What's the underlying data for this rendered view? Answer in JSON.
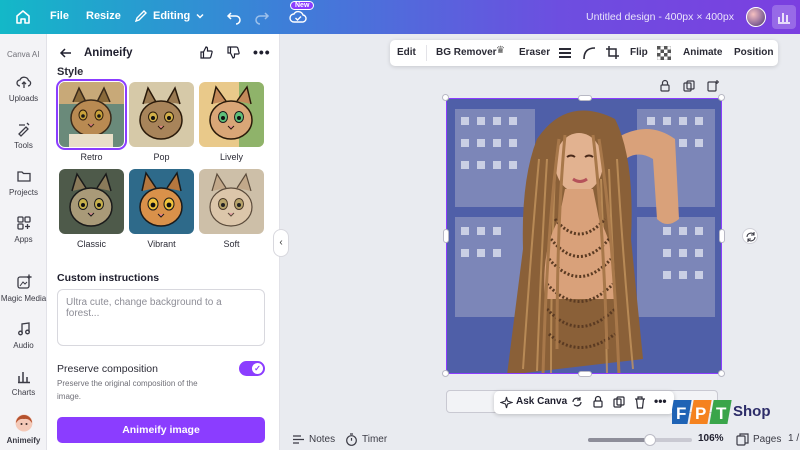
{
  "topbar": {
    "file_label": "File",
    "resize_label": "Resize",
    "mode_label": "Editing",
    "new_badge": "New",
    "document_title": "Untitled design - 400px × 400px"
  },
  "rail": {
    "brand": "Canva AI",
    "items": [
      {
        "label": "Uploads",
        "icon": "upload-icon"
      },
      {
        "label": "Tools",
        "icon": "tools-icon"
      },
      {
        "label": "Projects",
        "icon": "folder-icon"
      },
      {
        "label": "Apps",
        "icon": "apps-icon"
      },
      {
        "label": "Magic Media",
        "icon": "magic-media-icon"
      },
      {
        "label": "Audio",
        "icon": "audio-icon"
      },
      {
        "label": "Charts",
        "icon": "charts-icon"
      },
      {
        "label": "Animeify",
        "icon": "animeify-avatar"
      }
    ]
  },
  "panel": {
    "title": "Animeify",
    "style_heading": "Style",
    "styles": [
      {
        "label": "Retro",
        "selected": true
      },
      {
        "label": "Pop",
        "selected": false
      },
      {
        "label": "Lively",
        "selected": false
      },
      {
        "label": "Classic",
        "selected": false
      },
      {
        "label": "Vibrant",
        "selected": false
      },
      {
        "label": "Soft",
        "selected": false
      }
    ],
    "custom_heading": "Custom instructions",
    "custom_placeholder": "Ultra cute, change background to a forest...",
    "preserve_title": "Preserve composition",
    "preserve_desc": "Preserve the original composition of the image.",
    "preserve_enabled": true,
    "action_label": "Animeify image"
  },
  "context_bar": {
    "edit": "Edit",
    "bg_remover": "BG Remover",
    "eraser": "Eraser",
    "flip": "Flip",
    "animate": "Animate",
    "position": "Position"
  },
  "float_bar": {
    "ask_label": "Ask Canva"
  },
  "watermark": {
    "brand": "FPT",
    "shop": "Shop"
  },
  "footer": {
    "notes": "Notes",
    "timer": "Timer",
    "zoom": "106%",
    "zoom_level": 0.6,
    "pages": "Pages",
    "page_indicator": "1 /"
  },
  "colors": {
    "accent": "#8b3dff",
    "gradient_start": "#13b8c8",
    "gradient_end": "#7b3fe0"
  }
}
